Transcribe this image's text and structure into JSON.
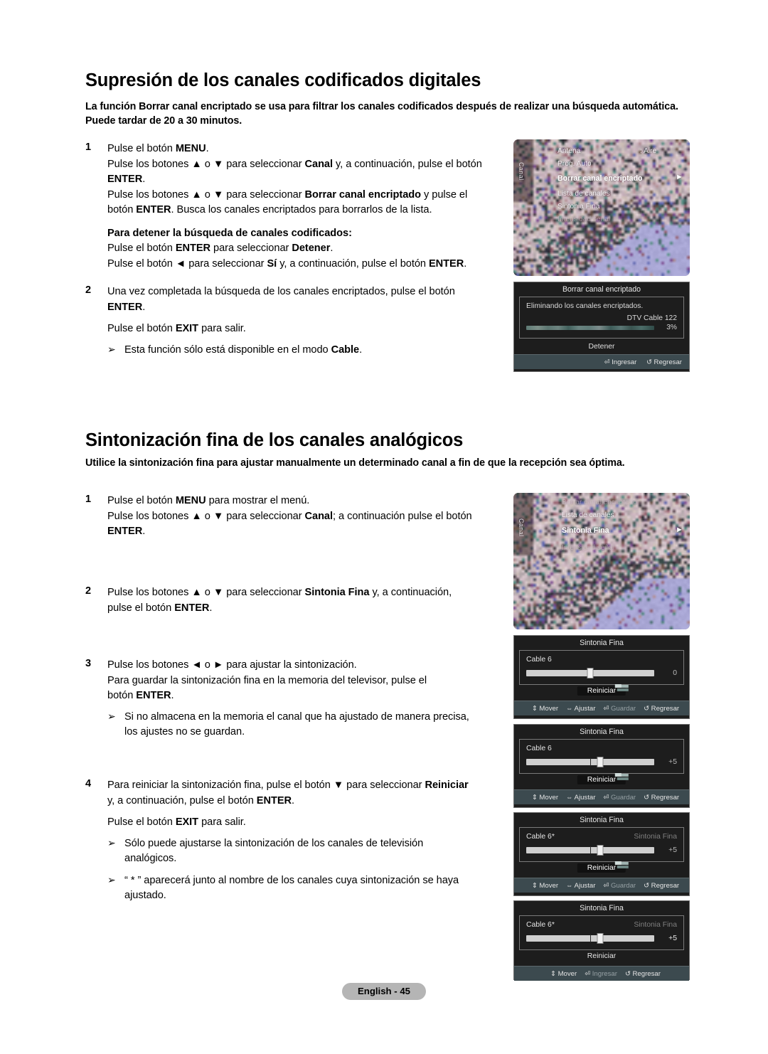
{
  "doc": {
    "page_badge": "English - 45"
  },
  "section1": {
    "heading": "Supresión de los canales codificados digitales",
    "lead": "La función Borrar canal encriptado se usa para filtrar los canales codificados después de realizar una búsqueda automática. Puede tardar de 20 a 30 minutos.",
    "step1": {
      "num": "1",
      "l1a": "Pulse el botón ",
      "l1b": "MENU",
      "l1c": ".",
      "l2a": "Pulse los botones ▲ o ▼ para seleccionar ",
      "l2b": "Canal",
      "l2c": " y, a continuación, pulse el botón",
      "l3a": "ENTER",
      "l3b": ".",
      "l4a": "Pulse los botones ▲ o ▼ para seleccionar ",
      "l4b": "Borrar canal encriptado",
      "l4c": " y pulse el",
      "l5a": "botón ",
      "l5b": "ENTER",
      "l5c": ". Busca los canales encriptados para borrarlos de la lista.",
      "sub_heading": "Para detener la búsqueda de canales codificados:",
      "s1a": "Pulse el botón ",
      "s1b": "ENTER",
      "s1c": " para seleccionar ",
      "s1d": "Detener",
      "s1e": ".",
      "s2a": "Pulse el botón ◄ para seleccionar ",
      "s2b": "Sí",
      "s2c": " y, a continuación, pulse el botón ",
      "s2d": "ENTER",
      "s2e": "."
    },
    "step2": {
      "num": "2",
      "l1": "Una vez completada la búsqueda de los canales encriptados, pulse el botón",
      "l2a": "ENTER",
      "l2b": ".",
      "l3a": "Pulse el botón ",
      "l3b": "EXIT",
      "l3c": " para salir.",
      "note_a": "Esta función sólo está disponible en el modo ",
      "note_b": "Cable",
      "note_c": "."
    }
  },
  "section2": {
    "heading": "Sintonización fina de los canales analógicos",
    "lead": "Utilice la sintonización fina para ajustar manualmente un determinado canal a fin de que la recepción sea óptima.",
    "step1": {
      "num": "1",
      "l1a": "Pulse el botón ",
      "l1b": "MENU",
      "l1c": " para mostrar el menú.",
      "l2a": "Pulse los botones ▲ o ▼ para seleccionar ",
      "l2b": "Canal",
      "l2c": "; a continuación pulse el botón",
      "l3a": "ENTER",
      "l3b": "."
    },
    "step2": {
      "num": "2",
      "l1a": "Pulse los botones ▲ o ▼ para seleccionar ",
      "l1b": "Sintonia Fina",
      "l1c": " y, a continuación,",
      "l2a": "pulse el botón ",
      "l2b": "ENTER",
      "l2c": "."
    },
    "step3": {
      "num": "3",
      "l1": "Pulse los botones ◄ o ► para ajustar la sintonización.",
      "l2": "Para guardar la sintonización fina en la memoria del televisor, pulse el",
      "l3a": "botón ",
      "l3b": "ENTER",
      "l3c": ".",
      "note1_l1": "Si no almacena en la memoria el canal que ha ajustado de manera precisa,",
      "note1_l2": "los ajustes no se guardan."
    },
    "step4": {
      "num": "4",
      "l1a": "Para reiniciar la sintonización fina, pulse el botón ▼ para seleccionar ",
      "l1b": "Reiniciar",
      "l2a": "y, a continuación, pulse el botón ",
      "l2b": "ENTER",
      "l2c": ".",
      "l3a": "Pulse el botón ",
      "l3b": "EXIT",
      "l3c": " para salir.",
      "note1_l1": "Sólo puede ajustarse la sintonización de los canales de televisión",
      "note1_l2": "analógicos.",
      "note2_l1": "“ * ” aparecerá junto al nombre de los canales cuya sintonización se haya",
      "note2_l2": "ajustado."
    }
  },
  "tv_menu_1": {
    "side_label": "Canal",
    "items": [
      {
        "label": "Antena",
        "state": "normal"
      },
      {
        "label": ": Aire",
        "state": "normal"
      },
      {
        "label": "Prog. Auto",
        "state": "normal"
      },
      {
        "label": "Borrar canal encriptado",
        "state": "selected"
      },
      {
        "label": "Lista de canales",
        "state": "normal"
      },
      {
        "label": "Sintonia Fina",
        "state": "normal"
      },
      {
        "label": "Intensidad señal",
        "state": "dim"
      }
    ],
    "chevron": "►"
  },
  "tv_menu_2": {
    "side_label": "Canal",
    "items": [
      {
        "label": "Borrar canal encriptado",
        "state": "dim"
      },
      {
        "label": "Lista de canales",
        "state": "normal"
      },
      {
        "label": "Sintonia Fina",
        "state": "selected"
      },
      {
        "label": "Intensidad señal",
        "state": "dim"
      }
    ],
    "chevron": "►"
  },
  "osd_borrar": {
    "title": "Borrar canal encriptado",
    "message": "Eliminando los canales encriptados.",
    "channel": "DTV Cable 122",
    "percent": "3%",
    "progress_value": 3,
    "action": "Detener",
    "footer": [
      {
        "icon": "enter-icon",
        "glyph": "⏎",
        "label": "Ingresar",
        "dim": false
      },
      {
        "icon": "return-icon",
        "glyph": "↺",
        "label": "Regresar",
        "dim": false
      }
    ]
  },
  "sf_panels": [
    {
      "title": "Sintonia Fina",
      "channel": "Cable 6",
      "ghost": "",
      "value": "0",
      "knob_pct": 50,
      "show_mid": false,
      "value_bright": false,
      "reset_label": "Reiniciar",
      "reset_highlighted": true,
      "footer": [
        {
          "icon": "updown-icon",
          "glyph": "⇕",
          "label": "Mover",
          "dim": false
        },
        {
          "icon": "leftright-icon",
          "glyph": "⇔",
          "label": "Ajustar",
          "dim": false
        },
        {
          "icon": "enter-icon",
          "glyph": "⏎",
          "label": "Guardar",
          "dim": true
        },
        {
          "icon": "return-icon",
          "glyph": "↺",
          "label": "Regresar",
          "dim": false
        }
      ]
    },
    {
      "title": "Sintonia Fina",
      "channel": "Cable 6",
      "ghost": "",
      "value": "+5",
      "knob_pct": 58,
      "show_mid": true,
      "value_bright": false,
      "reset_label": "Reiniciar",
      "reset_highlighted": true,
      "footer": [
        {
          "icon": "updown-icon",
          "glyph": "⇕",
          "label": "Mover",
          "dim": false
        },
        {
          "icon": "leftright-icon",
          "glyph": "⇔",
          "label": "Ajustar",
          "dim": false
        },
        {
          "icon": "enter-icon",
          "glyph": "⏎",
          "label": "Guardar",
          "dim": true
        },
        {
          "icon": "return-icon",
          "glyph": "↺",
          "label": "Regresar",
          "dim": false
        }
      ]
    },
    {
      "title": "Sintonia Fina",
      "channel": "Cable 6*",
      "ghost": "Sintonia Fina",
      "value": "+5",
      "knob_pct": 58,
      "show_mid": true,
      "value_bright": false,
      "reset_label": "Reiniciar",
      "reset_highlighted": true,
      "footer": [
        {
          "icon": "updown-icon",
          "glyph": "⇕",
          "label": "Mover",
          "dim": false
        },
        {
          "icon": "leftright-icon",
          "glyph": "⇔",
          "label": "Ajustar",
          "dim": false
        },
        {
          "icon": "enter-icon",
          "glyph": "⏎",
          "label": "Guardar",
          "dim": true
        },
        {
          "icon": "return-icon",
          "glyph": "↺",
          "label": "Regresar",
          "dim": false
        }
      ]
    },
    {
      "title": "Sintonia Fina",
      "channel": "Cable 6*",
      "ghost": "Sintonia Fina",
      "value": "+5",
      "knob_pct": 58,
      "show_mid": true,
      "value_bright": true,
      "reset_label": "Reiniciar",
      "reset_highlighted": false,
      "footer": [
        {
          "icon": "updown-icon",
          "glyph": "⇕",
          "label": "Mover",
          "dim": false
        },
        {
          "icon": "enter-icon",
          "glyph": "⏎",
          "label": "Ingresar",
          "dim": true
        },
        {
          "icon": "return-icon",
          "glyph": "↺",
          "label": "Regresar",
          "dim": false
        }
      ]
    }
  ]
}
